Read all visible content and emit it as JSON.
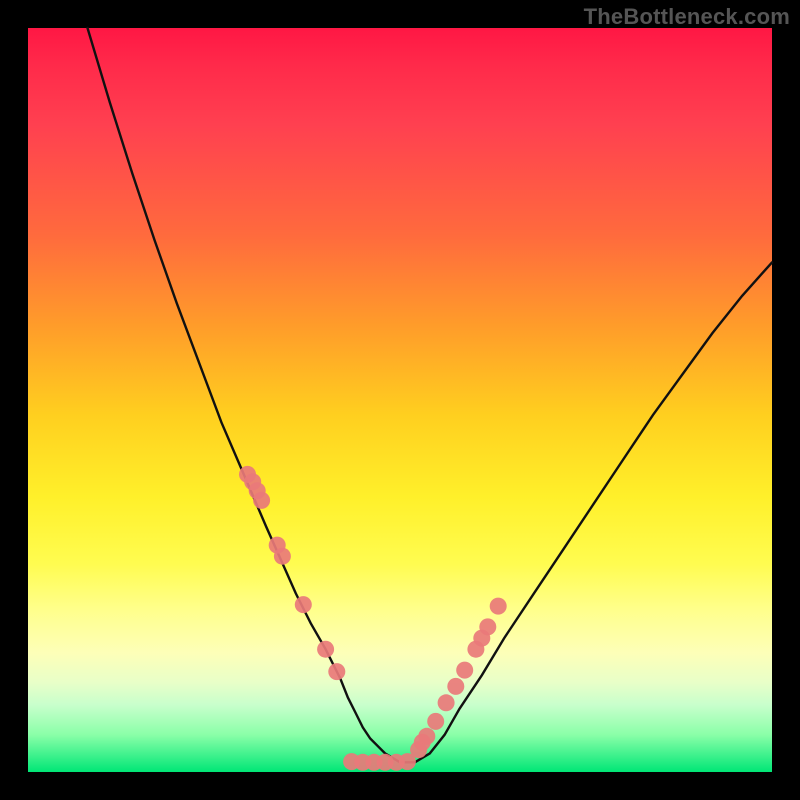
{
  "watermark": "TheBottleneck.com",
  "chart_data": {
    "type": "line",
    "title": "",
    "xlabel": "",
    "ylabel": "",
    "xlim": [
      0,
      100
    ],
    "ylim": [
      0,
      100
    ],
    "curve": {
      "name": "bottleneck-curve",
      "x": [
        8,
        11,
        14,
        17,
        20,
        23,
        26,
        29,
        32,
        34,
        36,
        38,
        40,
        42,
        43,
        44,
        45,
        46,
        48,
        50,
        52,
        54,
        56,
        58,
        61,
        64,
        68,
        72,
        76,
        80,
        84,
        88,
        92,
        96,
        100
      ],
      "y": [
        100,
        90,
        80.5,
        71.5,
        63,
        55,
        47,
        40,
        33,
        28.5,
        24,
        20,
        16.5,
        12.5,
        10,
        8,
        6,
        4.5,
        2.5,
        1.3,
        1.3,
        2.5,
        5,
        8.5,
        13,
        18,
        24,
        30,
        36,
        42,
        48,
        53.5,
        59,
        64,
        68.5
      ]
    },
    "points_left": {
      "name": "markers-left",
      "x": [
        29.5,
        30.2,
        30.8,
        31.4,
        33.5,
        34.2,
        37.0,
        40.0,
        41.5
      ],
      "y": [
        40.0,
        39.0,
        37.8,
        36.5,
        30.5,
        29.0,
        22.5,
        16.5,
        13.5
      ]
    },
    "points_right": {
      "name": "markers-right",
      "x": [
        52.5,
        53.0,
        53.6,
        54.8,
        56.2,
        57.5,
        58.7,
        60.2,
        61.0,
        61.8,
        63.2
      ],
      "y": [
        3.0,
        4.0,
        4.8,
        6.8,
        9.3,
        11.5,
        13.7,
        16.5,
        18.0,
        19.5,
        22.3
      ]
    },
    "points_bottom": {
      "name": "markers-bottom",
      "x": [
        43.5,
        45.0,
        46.5,
        48.0,
        49.5,
        51.0
      ],
      "y": [
        1.4,
        1.3,
        1.3,
        1.3,
        1.3,
        1.4
      ]
    },
    "marker_color": "#e97a7a",
    "curve_color": "#111111"
  }
}
